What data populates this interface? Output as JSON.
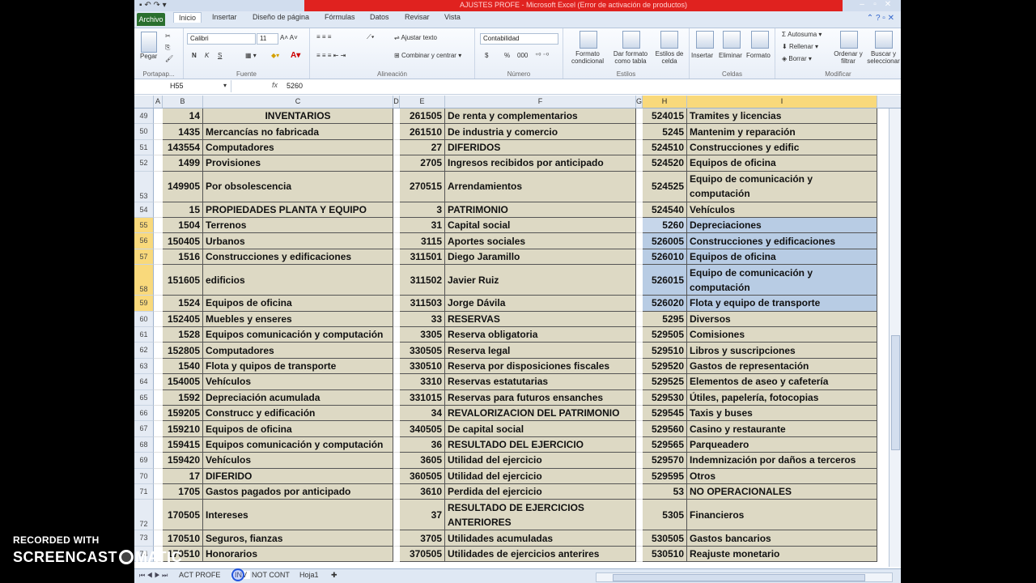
{
  "window": {
    "title": "AJUSTES PROFE - Microsoft Excel (Error de activación de productos)"
  },
  "tabs": [
    "Archivo",
    "Inicio",
    "Insertar",
    "Diseño de página",
    "Fórmulas",
    "Datos",
    "Revisar",
    "Vista"
  ],
  "ribbon": {
    "portapapeles": {
      "label": "Portapap...",
      "paste": "Pegar"
    },
    "fuente": {
      "label": "Fuente",
      "font": "Calibri",
      "size": "11",
      "bold": "N",
      "italic": "K",
      "underline": "S"
    },
    "alineacion": {
      "label": "Alineación",
      "wrap": "Ajustar texto",
      "merge": "Combinar y centrar"
    },
    "numero": {
      "label": "Número",
      "format": "Contabilidad",
      "currency": "$",
      "percent": "%",
      "thousands": "000"
    },
    "estilos": {
      "label": "Estilos",
      "cond": "Formato condicional",
      "table": "Dar formato como tabla",
      "cell": "Estilos de celda"
    },
    "celdas": {
      "label": "Celdas",
      "insert": "Insertar",
      "delete": "Eliminar",
      "format": "Formato"
    },
    "modificar": {
      "label": "Modificar",
      "autosum": "Autosuma",
      "fill": "Rellenar",
      "clear": "Borrar",
      "sort": "Ordenar y filtrar",
      "find": "Buscar y seleccionar"
    }
  },
  "formula_bar": {
    "cell": "H55",
    "fx": "fx",
    "value": "5260"
  },
  "columns": [
    "A",
    "B",
    "C",
    "D",
    "E",
    "F",
    "G",
    "H",
    "I"
  ],
  "rows": [
    {
      "n": "49",
      "b": "14",
      "c": "INVENTARIOS",
      "e": "261505",
      "f": "De renta y complementarios",
      "h": "524015",
      "i": "Tramites y licencias"
    },
    {
      "n": "50",
      "b": "1435",
      "c": "Mercancías no fabricada",
      "e": "261510",
      "f": "De industria y comercio",
      "h": "5245",
      "i": "Mantenim y reparación"
    },
    {
      "n": "51",
      "b": "143554",
      "c": "Computadores",
      "e": "27",
      "f": "DIFERIDOS",
      "h": "524510",
      "i": "Construcciones y edific"
    },
    {
      "n": "52",
      "b": "1499",
      "c": "Provisiones",
      "e": "2705",
      "f": "Ingresos recibidos por anticipado",
      "h": "524520",
      "i": "Equipos de oficina"
    },
    {
      "n": "53",
      "b": "149905",
      "c": "Por obsolescencia",
      "e": "270515",
      "f": "Arrendamientos",
      "h": "524525",
      "i": "Equipo de comunicación y computación"
    },
    {
      "n": "54",
      "b": "15",
      "c": "PROPIEDADES PLANTA Y EQUIPO",
      "e": "3",
      "f": "PATRIMONIO",
      "h": "524540",
      "i": "Vehículos"
    },
    {
      "n": "55",
      "b": "1504",
      "c": "Terrenos",
      "e": "31",
      "f": "Capital social",
      "h": "5260",
      "i": "Depreciaciones"
    },
    {
      "n": "56",
      "b": "150405",
      "c": "Urbanos",
      "e": "3115",
      "f": "Aportes sociales",
      "h": "526005",
      "i": "Construcciones y edificaciones"
    },
    {
      "n": "57",
      "b": "1516",
      "c": "Construcciones y edificaciones",
      "e": "311501",
      "f": "Diego Jaramillo",
      "h": "526010",
      "i": "Equipos de oficina"
    },
    {
      "n": "58",
      "b": "151605",
      "c": "edificios",
      "e": "311502",
      "f": "Javier Ruiz",
      "h": "526015",
      "i": "Equipo de comunicación y computación"
    },
    {
      "n": "59",
      "b": "1524",
      "c": "Equipos de oficina",
      "e": "311503",
      "f": "Jorge Dávila",
      "h": "526020",
      "i": "Flota y equipo de transporte"
    },
    {
      "n": "60",
      "b": "152405",
      "c": "Muebles y enseres",
      "e": "33",
      "f": "RESERVAS",
      "h": "5295",
      "i": "Diversos"
    },
    {
      "n": "61",
      "b": "1528",
      "c": "Equipos  comunicación y computación",
      "e": "3305",
      "f": "Reserva obligatoria",
      "h": "529505",
      "i": "Comisiones"
    },
    {
      "n": "62",
      "b": "152805",
      "c": "Computadores",
      "e": "330505",
      "f": "Reserva legal",
      "h": "529510",
      "i": "Libros y suscripciones"
    },
    {
      "n": "63",
      "b": "1540",
      "c": "Flota y quipos de transporte",
      "e": "330510",
      "f": "Reserva por disposiciones fiscales",
      "h": "529520",
      "i": "Gastos de representación"
    },
    {
      "n": "64",
      "b": "154005",
      "c": "Vehículos",
      "e": "3310",
      "f": "Reservas estatutarias",
      "h": "529525",
      "i": "Elementos de aseo y cafetería"
    },
    {
      "n": "65",
      "b": "1592",
      "c": "Depreciación acumulada",
      "e": "331015",
      "f": "Reservas para futuros ensanches",
      "h": "529530",
      "i": "Útiles, papelería, fotocopias"
    },
    {
      "n": "66",
      "b": "159205",
      "c": "Construcc y edificación",
      "e": "34",
      "f": "REVALORIZACION DEL PATRIMONIO",
      "h": "529545",
      "i": "Taxis y buses"
    },
    {
      "n": "67",
      "b": "159210",
      "c": "Equipos de oficina",
      "e": "340505",
      "f": "De capital social",
      "h": "529560",
      "i": "Casino y restaurante"
    },
    {
      "n": "68",
      "b": "159415",
      "c": "Equipos  comunicación y computación",
      "e": "36",
      "f": "RESULTADO DEL EJERCICIO",
      "h": "529565",
      "i": "Parqueadero"
    },
    {
      "n": "69",
      "b": "159420",
      "c": "Vehículos",
      "e": "3605",
      "f": "Utilidad del ejercicio",
      "h": "529570",
      "i": "Indemnización por daños a terceros"
    },
    {
      "n": "70",
      "b": "17",
      "c": "DIFERIDO",
      "e": "360505",
      "f": "Utilidad del ejercicio",
      "h": "529595",
      "i": "Otros"
    },
    {
      "n": "71",
      "b": "1705",
      "c": "Gastos pagados por anticipado",
      "e": "3610",
      "f": "Perdida del ejercicio",
      "h": "53",
      "i": "NO OPERACIONALES"
    },
    {
      "n": "72",
      "b": "170505",
      "c": "Intereses",
      "e": "37",
      "f": "RESULTADO DE EJERCICIOS ANTERIORES",
      "h": "5305",
      "i": "Financieros"
    },
    {
      "n": "73",
      "b": "170510",
      "c": "Seguros, fianzas",
      "e": "3705",
      "f": "Utilidades acumuladas",
      "h": "530505",
      "i": "Gastos bancarios"
    },
    {
      "n": "74",
      "b": "170510",
      "c": "Honorarios",
      "e": "370505",
      "f": "Utilidades de ejercicios anterires",
      "h": "530510",
      "i": "Reajuste monetario"
    }
  ],
  "sheets": [
    "ACT PROFE",
    "INV",
    "NOT CONT",
    "Hoja1"
  ],
  "watermark": {
    "line1": "RECORDED WITH",
    "line2a": "SCREENCAST",
    "line2b": "MATIC"
  }
}
